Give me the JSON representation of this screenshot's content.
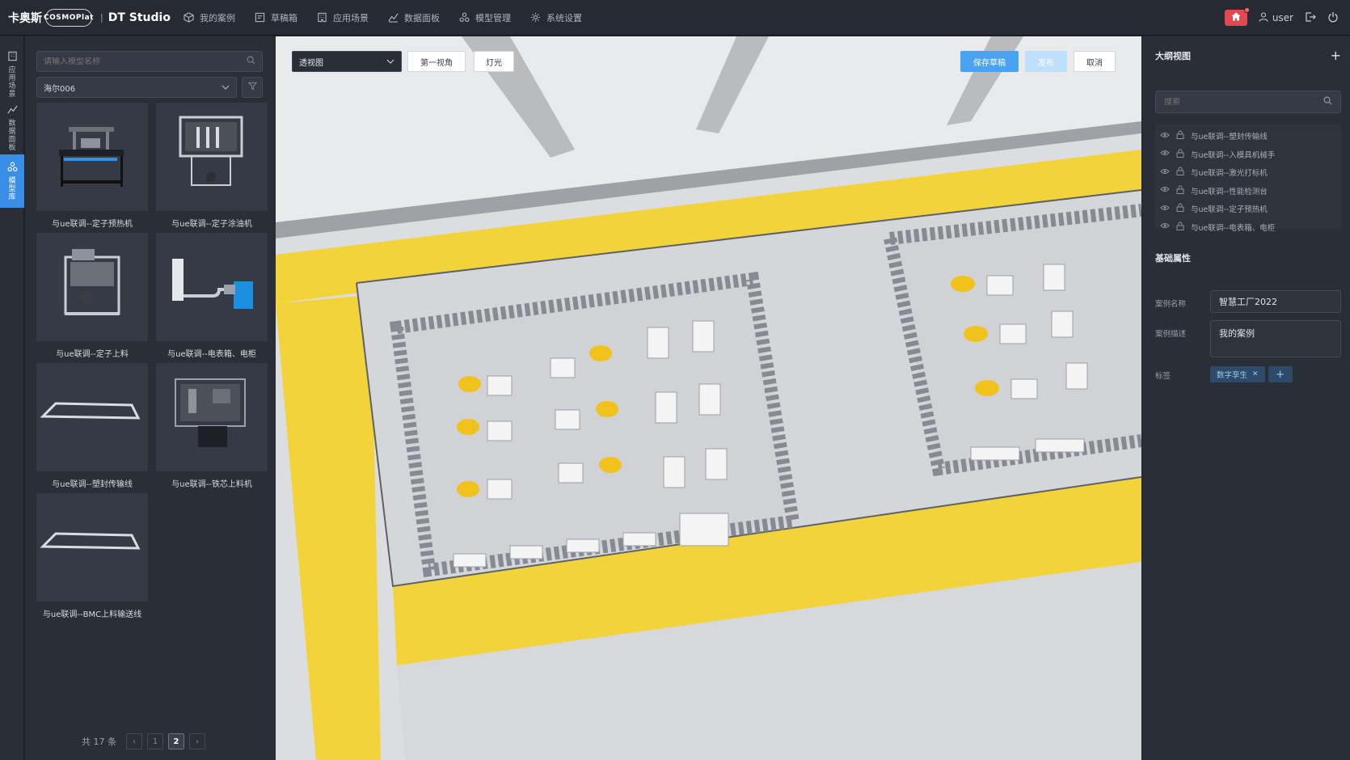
{
  "brand": {
    "name_zh": "卡奥斯",
    "logo_text": "COSMOPlat",
    "divider": "|",
    "product": "DT Studio"
  },
  "nav": [
    {
      "label": "我的案例",
      "icon": "cube-icon"
    },
    {
      "label": "草稿箱",
      "icon": "draft-icon"
    },
    {
      "label": "应用场景",
      "icon": "building-icon"
    },
    {
      "label": "数据面板",
      "icon": "chart-icon"
    },
    {
      "label": "模型管理",
      "icon": "model-icon"
    },
    {
      "label": "系统设置",
      "icon": "gear-icon"
    }
  ],
  "topbar_right": {
    "username": "user"
  },
  "rail": [
    {
      "label": "应用场景",
      "icon": "building-icon",
      "active": false
    },
    {
      "label": "数据面板",
      "icon": "chart-icon",
      "active": false
    },
    {
      "label": "模型库",
      "icon": "model-icon",
      "active": true
    }
  ],
  "library": {
    "search_placeholder": "请输入模型名称",
    "category": "海尔006",
    "models": [
      {
        "label": "与ue联调--定子预热机"
      },
      {
        "label": "与ue联调--定子涂油机"
      },
      {
        "label": "与ue联调--定子上料"
      },
      {
        "label": "与ue联调--电表箱、电柜"
      },
      {
        "label": "与ue联调--塑封传输线"
      },
      {
        "label": "与ue联调--铁芯上料机"
      },
      {
        "label": "与ue联调--BMC上料输送线"
      }
    ],
    "pagination": {
      "total_text": "共 17 条",
      "prev": "‹",
      "page_prev": "1",
      "current": "2",
      "next": "›"
    }
  },
  "viewport": {
    "view_mode": "透视图",
    "first_person_label": "第一视角",
    "lights_label": "灯光",
    "save_draft_label": "保存草稿",
    "publish_label": "发布",
    "cancel_label": "取消"
  },
  "props": {
    "outline_title": "大纲视图",
    "outline_add": "+",
    "search_placeholder": "搜索",
    "outline_items": [
      "与ue联调--塑封传输线",
      "与ue联调--入模具机械手",
      "与ue联调--激光打标机",
      "与ue联调--性能检测台",
      "与ue联调--定子预热机",
      "与ue联调--电表箱、电柜"
    ],
    "basic_title": "基础属性",
    "name_label": "案例名称",
    "name_value": "智慧工厂2022",
    "desc_label": "案例描述",
    "desc_value": "我的案例",
    "tag_label": "标签",
    "tag_value": "数字孪生",
    "tag_remove": "✕",
    "tag_add": "+"
  },
  "colors": {
    "accent": "#4aa3f0",
    "floor_yellow": "#f2d43a",
    "robot_yellow": "#f1c21b",
    "danger": "#e5474f"
  }
}
